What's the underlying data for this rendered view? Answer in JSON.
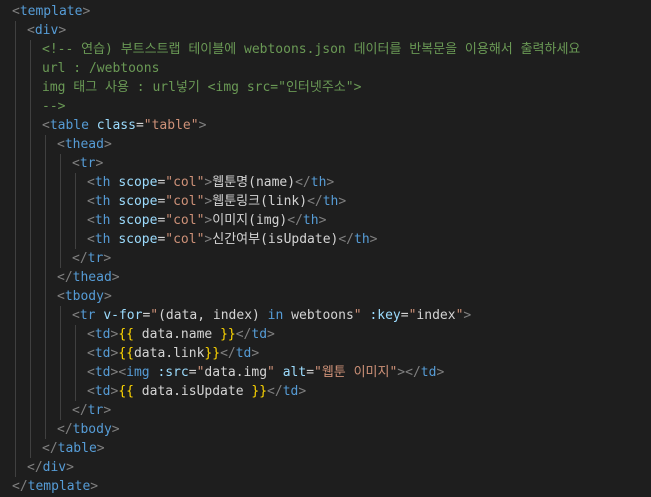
{
  "editor": {
    "lines": [
      {
        "indent": 0,
        "tokens": [
          {
            "t": "<",
            "c": "punct"
          },
          {
            "t": "template",
            "c": "tag"
          },
          {
            "t": ">",
            "c": "punct"
          }
        ]
      },
      {
        "indent": 1,
        "tokens": [
          {
            "t": "<",
            "c": "punct"
          },
          {
            "t": "div",
            "c": "tag"
          },
          {
            "t": ">",
            "c": "punct"
          }
        ]
      },
      {
        "indent": 2,
        "tokens": [
          {
            "t": "<!-- 연습) 부트스트랩 테이블에 webtoons.json 데이터를 반복문을 이용해서 출력하세요",
            "c": "cmt"
          }
        ]
      },
      {
        "indent": 2,
        "tokens": [
          {
            "t": "url : /webtoons",
            "c": "cmt"
          }
        ]
      },
      {
        "indent": 2,
        "tokens": [
          {
            "t": "img 태그 사용 : url넣기 <img src=\"인터넷주소\">",
            "c": "cmt"
          }
        ]
      },
      {
        "indent": 2,
        "tokens": [
          {
            "t": "-->",
            "c": "cmt"
          }
        ]
      },
      {
        "indent": 2,
        "tokens": [
          {
            "t": "<",
            "c": "punct"
          },
          {
            "t": "table",
            "c": "tag"
          },
          {
            "t": " ",
            "c": "text"
          },
          {
            "t": "class",
            "c": "attr"
          },
          {
            "t": "=",
            "c": "text"
          },
          {
            "t": "\"table\"",
            "c": "str"
          },
          {
            "t": ">",
            "c": "punct"
          }
        ]
      },
      {
        "indent": 3,
        "tokens": [
          {
            "t": "<",
            "c": "punct"
          },
          {
            "t": "thead",
            "c": "tag"
          },
          {
            "t": ">",
            "c": "punct"
          }
        ]
      },
      {
        "indent": 4,
        "tokens": [
          {
            "t": "<",
            "c": "punct"
          },
          {
            "t": "tr",
            "c": "tag"
          },
          {
            "t": ">",
            "c": "punct"
          }
        ]
      },
      {
        "indent": 5,
        "tokens": [
          {
            "t": "<",
            "c": "punct"
          },
          {
            "t": "th",
            "c": "tag"
          },
          {
            "t": " ",
            "c": "text"
          },
          {
            "t": "scope",
            "c": "attr"
          },
          {
            "t": "=",
            "c": "text"
          },
          {
            "t": "\"col\"",
            "c": "str"
          },
          {
            "t": ">",
            "c": "punct"
          },
          {
            "t": "웹툰명(name)",
            "c": "text"
          },
          {
            "t": "</",
            "c": "punct"
          },
          {
            "t": "th",
            "c": "tag"
          },
          {
            "t": ">",
            "c": "punct"
          }
        ]
      },
      {
        "indent": 5,
        "tokens": [
          {
            "t": "<",
            "c": "punct"
          },
          {
            "t": "th",
            "c": "tag"
          },
          {
            "t": " ",
            "c": "text"
          },
          {
            "t": "scope",
            "c": "attr"
          },
          {
            "t": "=",
            "c": "text"
          },
          {
            "t": "\"col\"",
            "c": "str"
          },
          {
            "t": ">",
            "c": "punct"
          },
          {
            "t": "웹툰링크(link)",
            "c": "text"
          },
          {
            "t": "</",
            "c": "punct"
          },
          {
            "t": "th",
            "c": "tag"
          },
          {
            "t": ">",
            "c": "punct"
          }
        ]
      },
      {
        "indent": 5,
        "tokens": [
          {
            "t": "<",
            "c": "punct"
          },
          {
            "t": "th",
            "c": "tag"
          },
          {
            "t": " ",
            "c": "text"
          },
          {
            "t": "scope",
            "c": "attr"
          },
          {
            "t": "=",
            "c": "text"
          },
          {
            "t": "\"col\"",
            "c": "str"
          },
          {
            "t": ">",
            "c": "punct"
          },
          {
            "t": "이미지(img)",
            "c": "text"
          },
          {
            "t": "</",
            "c": "punct"
          },
          {
            "t": "th",
            "c": "tag"
          },
          {
            "t": ">",
            "c": "punct"
          }
        ]
      },
      {
        "indent": 5,
        "tokens": [
          {
            "t": "<",
            "c": "punct"
          },
          {
            "t": "th",
            "c": "tag"
          },
          {
            "t": " ",
            "c": "text"
          },
          {
            "t": "scope",
            "c": "attr"
          },
          {
            "t": "=",
            "c": "text"
          },
          {
            "t": "\"col\"",
            "c": "str"
          },
          {
            "t": ">",
            "c": "punct"
          },
          {
            "t": "신간여부(isUpdate)",
            "c": "text"
          },
          {
            "t": "</",
            "c": "punct"
          },
          {
            "t": "th",
            "c": "tag"
          },
          {
            "t": ">",
            "c": "punct"
          }
        ]
      },
      {
        "indent": 4,
        "tokens": [
          {
            "t": "</",
            "c": "punct"
          },
          {
            "t": "tr",
            "c": "tag"
          },
          {
            "t": ">",
            "c": "punct"
          }
        ]
      },
      {
        "indent": 3,
        "tokens": [
          {
            "t": "</",
            "c": "punct"
          },
          {
            "t": "thead",
            "c": "tag"
          },
          {
            "t": ">",
            "c": "punct"
          }
        ]
      },
      {
        "indent": 3,
        "tokens": [
          {
            "t": "<",
            "c": "punct"
          },
          {
            "t": "tbody",
            "c": "tag"
          },
          {
            "t": ">",
            "c": "punct"
          }
        ]
      },
      {
        "indent": 4,
        "tokens": [
          {
            "t": "<",
            "c": "punct"
          },
          {
            "t": "tr",
            "c": "tag"
          },
          {
            "t": " ",
            "c": "text"
          },
          {
            "t": "v-for",
            "c": "attr"
          },
          {
            "t": "=",
            "c": "text"
          },
          {
            "t": "\"",
            "c": "str"
          },
          {
            "t": "(data, index)",
            "c": "text"
          },
          {
            "t": " in ",
            "c": "kw"
          },
          {
            "t": "webtoons",
            "c": "text"
          },
          {
            "t": "\"",
            "c": "str"
          },
          {
            "t": " ",
            "c": "text"
          },
          {
            "t": ":key",
            "c": "attr"
          },
          {
            "t": "=",
            "c": "text"
          },
          {
            "t": "\"",
            "c": "str"
          },
          {
            "t": "index",
            "c": "text"
          },
          {
            "t": "\"",
            "c": "str"
          },
          {
            "t": ">",
            "c": "punct"
          }
        ]
      },
      {
        "indent": 5,
        "tokens": [
          {
            "t": "<",
            "c": "punct"
          },
          {
            "t": "td",
            "c": "tag"
          },
          {
            "t": ">",
            "c": "punct"
          },
          {
            "t": "{{",
            "c": "mus"
          },
          {
            "t": " data.name ",
            "c": "text"
          },
          {
            "t": "}}",
            "c": "mus"
          },
          {
            "t": "</",
            "c": "punct"
          },
          {
            "t": "td",
            "c": "tag"
          },
          {
            "t": ">",
            "c": "punct"
          }
        ]
      },
      {
        "indent": 5,
        "tokens": [
          {
            "t": "<",
            "c": "punct"
          },
          {
            "t": "td",
            "c": "tag"
          },
          {
            "t": ">",
            "c": "punct"
          },
          {
            "t": "{{",
            "c": "mus"
          },
          {
            "t": "data.link",
            "c": "text"
          },
          {
            "t": "}}",
            "c": "mus"
          },
          {
            "t": "</",
            "c": "punct"
          },
          {
            "t": "td",
            "c": "tag"
          },
          {
            "t": ">",
            "c": "punct"
          }
        ]
      },
      {
        "indent": 5,
        "tokens": [
          {
            "t": "<",
            "c": "punct"
          },
          {
            "t": "td",
            "c": "tag"
          },
          {
            "t": ">",
            "c": "punct"
          },
          {
            "t": "<",
            "c": "punct"
          },
          {
            "t": "img",
            "c": "tag"
          },
          {
            "t": " ",
            "c": "text"
          },
          {
            "t": ":src",
            "c": "attr"
          },
          {
            "t": "=",
            "c": "text"
          },
          {
            "t": "\"",
            "c": "str"
          },
          {
            "t": "data.img",
            "c": "text"
          },
          {
            "t": "\"",
            "c": "str"
          },
          {
            "t": " ",
            "c": "text"
          },
          {
            "t": "alt",
            "c": "attr"
          },
          {
            "t": "=",
            "c": "text"
          },
          {
            "t": "\"웹툰 이미지\"",
            "c": "str"
          },
          {
            "t": ">",
            "c": "punct"
          },
          {
            "t": "</",
            "c": "punct"
          },
          {
            "t": "td",
            "c": "tag"
          },
          {
            "t": ">",
            "c": "punct"
          }
        ]
      },
      {
        "indent": 5,
        "tokens": [
          {
            "t": "<",
            "c": "punct"
          },
          {
            "t": "td",
            "c": "tag"
          },
          {
            "t": ">",
            "c": "punct"
          },
          {
            "t": "{{",
            "c": "mus"
          },
          {
            "t": " data.isUpdate ",
            "c": "text"
          },
          {
            "t": "}}",
            "c": "mus"
          },
          {
            "t": "</",
            "c": "punct"
          },
          {
            "t": "td",
            "c": "tag"
          },
          {
            "t": ">",
            "c": "punct"
          }
        ]
      },
      {
        "indent": 4,
        "tokens": [
          {
            "t": "</",
            "c": "punct"
          },
          {
            "t": "tr",
            "c": "tag"
          },
          {
            "t": ">",
            "c": "punct"
          }
        ]
      },
      {
        "indent": 3,
        "tokens": [
          {
            "t": "</",
            "c": "punct"
          },
          {
            "t": "tbody",
            "c": "tag"
          },
          {
            "t": ">",
            "c": "punct"
          }
        ]
      },
      {
        "indent": 2,
        "tokens": [
          {
            "t": "</",
            "c": "punct"
          },
          {
            "t": "table",
            "c": "tag"
          },
          {
            "t": ">",
            "c": "punct"
          }
        ]
      },
      {
        "indent": 1,
        "tokens": [
          {
            "t": "</",
            "c": "punct"
          },
          {
            "t": "div",
            "c": "tag"
          },
          {
            "t": ">",
            "c": "punct"
          }
        ]
      },
      {
        "indent": 0,
        "tokens": [
          {
            "t": "</",
            "c": "punct"
          },
          {
            "t": "template",
            "c": "tag"
          },
          {
            "t": ">",
            "c": "punct"
          }
        ]
      }
    ]
  }
}
